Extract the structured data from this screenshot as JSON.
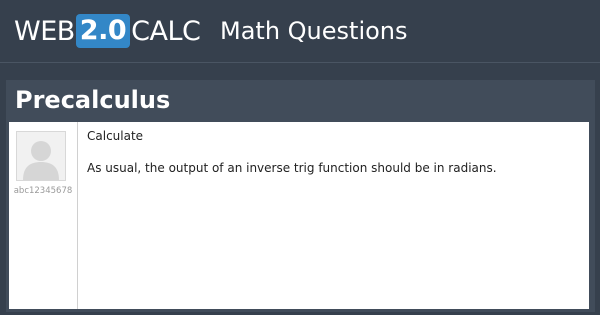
{
  "header": {
    "logo_prefix": "WEB",
    "logo_badge": "2.0",
    "logo_suffix": "CALC",
    "site_title": "Math Questions"
  },
  "panel": {
    "title": "Precalculus"
  },
  "question": {
    "username": "abc12345678",
    "lines": [
      "Calculate",
      "As usual, the output of an inverse trig function should be in radians."
    ]
  },
  "colors": {
    "background": "#36404d",
    "panel": "#414c5a",
    "badge": "#3387c7",
    "card": "#ffffff"
  }
}
